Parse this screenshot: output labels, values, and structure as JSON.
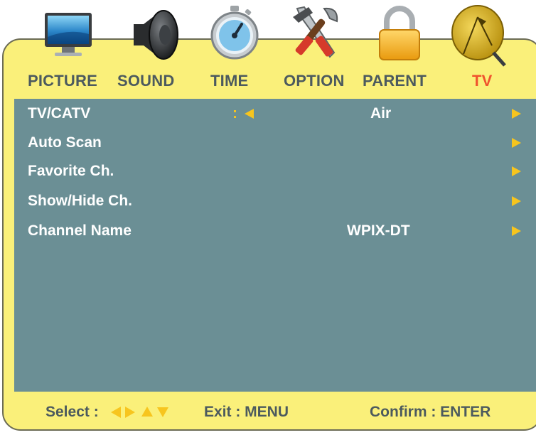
{
  "tabs": [
    {
      "label": "PICTURE",
      "icon": "monitor-icon",
      "active": false
    },
    {
      "label": "SOUND",
      "icon": "speaker-icon",
      "active": false
    },
    {
      "label": "TIME",
      "icon": "stopwatch-icon",
      "active": false
    },
    {
      "label": "OPTION",
      "icon": "tools-icon",
      "active": false
    },
    {
      "label": "PARENT",
      "icon": "padlock-icon",
      "active": false
    },
    {
      "label": "TV",
      "icon": "satellite-dish-icon",
      "active": true
    }
  ],
  "rows": [
    {
      "label": "TV/CATV",
      "separator": ":",
      "value": "Air"
    },
    {
      "label": "Auto Scan",
      "value": ""
    },
    {
      "label": "Favorite Ch.",
      "value": ""
    },
    {
      "label": "Show/Hide Ch.",
      "value": ""
    },
    {
      "label": "Channel Name",
      "value": "WPIX-DT"
    }
  ],
  "footer": {
    "select_label": "Select :",
    "exit_label": "Exit : MENU",
    "confirm_label": "Confirm : ENTER"
  },
  "colors": {
    "frame": "#faf07a",
    "panel": "#6b8f95",
    "active_tab": "#f0532d",
    "arrow": "#f7c51e"
  }
}
